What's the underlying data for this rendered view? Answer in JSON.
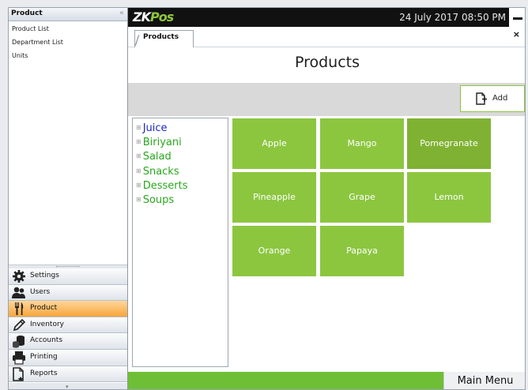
{
  "sidebar": {
    "title": "Product",
    "collapse_glyph": "«",
    "sub_items": [
      {
        "label": "Product List"
      },
      {
        "label": "Department List"
      },
      {
        "label": "Units"
      }
    ],
    "modules": [
      {
        "label": "Settings",
        "icon": "gear-icon"
      },
      {
        "label": "Users",
        "icon": "users-icon"
      },
      {
        "label": "Product",
        "icon": "fork-knife-icon",
        "active": true
      },
      {
        "label": "Inventory",
        "icon": "pencil-icon"
      },
      {
        "label": "Accounts",
        "icon": "coins-icon"
      },
      {
        "label": "Printing",
        "icon": "printer-icon"
      },
      {
        "label": "Reports",
        "icon": "report-icon"
      }
    ]
  },
  "header": {
    "logo_zk": "ZK",
    "logo_pos": "Pos",
    "datetime": "24 July 2017 08:50 PM"
  },
  "tabs": [
    {
      "label": "Products",
      "active": true
    }
  ],
  "tab_close": "×",
  "page": {
    "title": "Products",
    "add_label": "Add"
  },
  "categories": [
    {
      "label": "Juice",
      "selected": true
    },
    {
      "label": "Biriyani"
    },
    {
      "label": "Salad"
    },
    {
      "label": "Snacks"
    },
    {
      "label": "Desserts"
    },
    {
      "label": "Soups"
    }
  ],
  "products": [
    {
      "label": "Apple"
    },
    {
      "label": "Mango"
    },
    {
      "label": "Pomegranate",
      "selected": true
    },
    {
      "label": "Pineapple"
    },
    {
      "label": "Grape"
    },
    {
      "label": "Lemon"
    },
    {
      "label": "Orange"
    },
    {
      "label": "Papaya"
    }
  ],
  "footer": {
    "main_menu_label": "Main Menu"
  },
  "colors": {
    "accent_green": "#8cc63f",
    "active_module": "#f6a53c",
    "selected_category": "#1b28c9",
    "category_text": "#29a81d"
  }
}
